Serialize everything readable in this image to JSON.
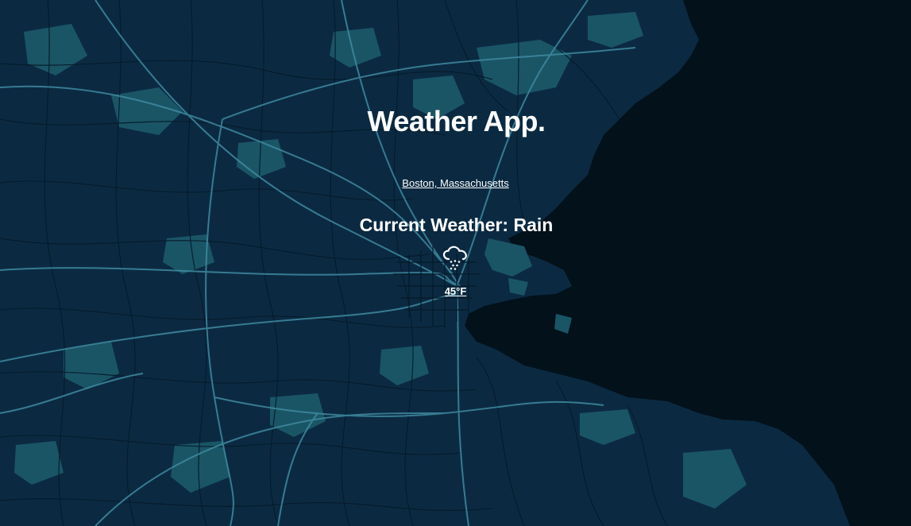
{
  "app": {
    "title": "Weather App.",
    "location": "Boston, Massachusetts",
    "condition_text": "Current Weather: Rain",
    "temperature": "45°F"
  },
  "icons": {
    "weather": "cloud-rain-icon"
  },
  "colors": {
    "land": "#0b2a42",
    "water": "#03111b",
    "parks": "#1a5566",
    "roads_major": "#3f8aa0",
    "roads_minor": "#061a29",
    "text": "#ffffff"
  }
}
